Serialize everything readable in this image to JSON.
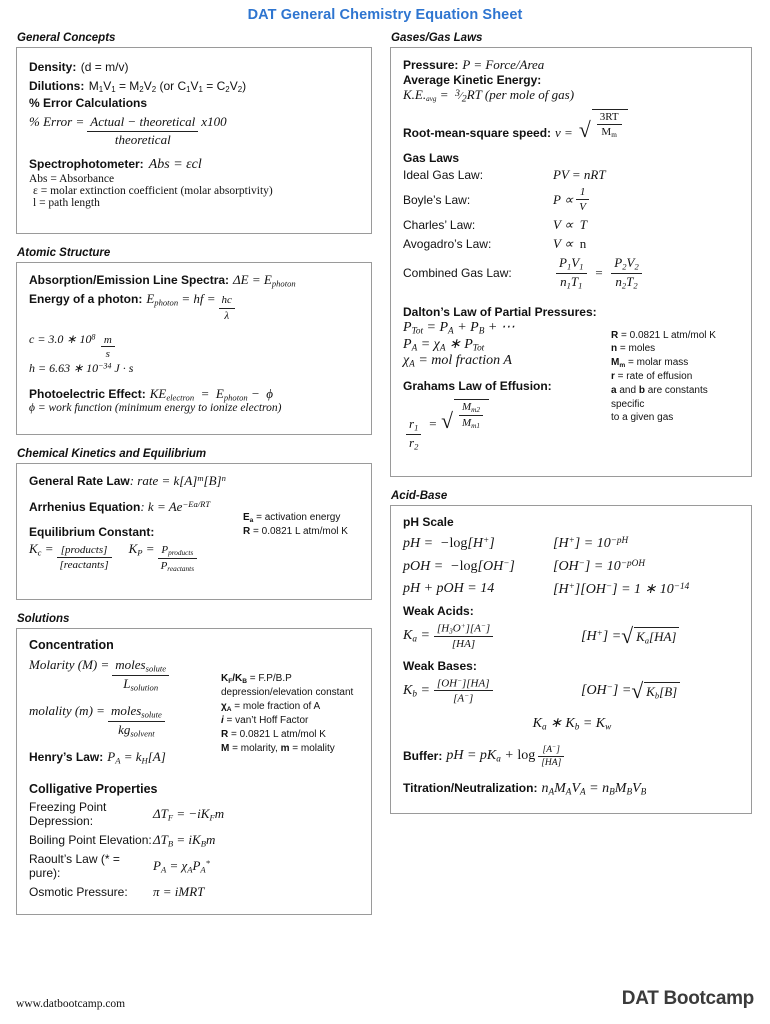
{
  "title": "DAT General Chemistry Equation Sheet",
  "title_color": "#2E75D0",
  "footer": {
    "url": "www.datbootcamp.com",
    "logo": "DAT Bootcamp"
  },
  "sections": {
    "general_concepts": {
      "heading": "General Concepts",
      "density_label": "Density:",
      "density_eq": "(d = m/v)",
      "dilutions_label": "Dilutions:",
      "dilutions_eq": "M1V1 = M2V2 (or C1V1 = C2V2)",
      "error_label": "% Error Calculations",
      "error_lhs": "% Error  = ",
      "error_num": "Actual − theoretical",
      "error_den": "theoretical",
      "error_tail": "x100",
      "spectro_label": "Spectrophotometer:",
      "spectro_eq": "Abs  =  εcl",
      "spectro_n1": "Abs = Absorbance",
      "spectro_n2": "ε = molar extinction coefficient (molar absorptivity)",
      "spectro_n3": "l = path length"
    },
    "atomic_structure": {
      "heading": "Atomic Structure",
      "line_spectra_label": "Absorption/Emission Line Spectra:",
      "line_spectra_eq": "ΔE = E",
      "line_spectra_sub": "photon",
      "photon_label": "Energy of a photon:",
      "photon_lhs": "E",
      "photon_lhs_sub": "photon",
      "photon_mid": " = hf = ",
      "photon_num": "hc",
      "photon_den": "λ",
      "const_c": "c = 3.0 ∗ 10",
      "const_c_exp": "8",
      "const_c_num": "m",
      "const_c_den": "s",
      "const_h": "h = 6.63 ∗ 10",
      "const_h_exp": "−34",
      "const_h_unit": "J · s",
      "photoelectric_label": "Photoelectric Effect:",
      "photoelectric_eq": "KE",
      "photoelectric_sub": "electron",
      "photoelectric_mid": "  =  E",
      "photoelectric_sub2": "photon",
      "photoelectric_end": " −  ϕ",
      "work_note": "ϕ = work function (minimum energy to ionize electron)"
    },
    "kinetics": {
      "heading": "Chemical Kinetics and Equilibrium",
      "rate_label": "General Rate Law",
      "rate_eq": ": rate = k[A]",
      "rate_sup1": "m",
      "rate_b": "[B]",
      "rate_sup2": "n",
      "arrhenius_label": "Arrhenius Equation",
      "arrhenius_eq": ": k = Ae",
      "arrhenius_exp": "−Ea/RT",
      "equil_label": "Equilibrium Constant:",
      "kc": "K",
      "kc_sub": "c",
      "kc_num": "[products]",
      "kc_den": "[reactants]",
      "kp": "K",
      "kp_sub": "P",
      "kp_num": "P",
      "kp_num_sub": "products",
      "kp_den": "P",
      "kp_den_sub": "reactants",
      "notes": [
        {
          "sym": "E",
          "sub": "a",
          "text": " = activation energy"
        },
        {
          "sym": "R",
          "sub": "",
          "text": " = 0.0821 L atm/mol K"
        }
      ]
    },
    "solutions": {
      "heading": "Solutions",
      "conc_label": "Concentration",
      "molarity_lhs": "Molarity (M)  = ",
      "molarity_num": "moles",
      "molarity_num_sub": "solute",
      "molarity_den": "L",
      "molarity_den_sub": "solution",
      "molality_lhs": "molality (m)  = ",
      "molality_num": "moles",
      "molality_num_sub": "solute",
      "molality_den": "kg",
      "molality_den_sub": "solvent",
      "henry_label": "Henry’s Law:",
      "henry_eq": "P",
      "henry_sub": "A",
      "henry_rest": " = k",
      "henry_sub2": "H",
      "henry_end": "[A]",
      "notes": [
        "K_F/K_B = F.P/B.P depression/elevation constant",
        "χ_A = mole fraction of A",
        "i = van’t Hoff Factor",
        "R = 0.0821 L atm/mol K",
        "M = molarity, m = molality"
      ],
      "note_kf_sym": "K",
      "note_kf_sub": "F",
      "note_kb_sym": "K",
      "note_kb_sub": "B",
      "note_kf_text": " = F.P/B.P",
      "note_kf_text2": "depression/elevation",
      "note_kf_text3": "constant",
      "note_chi_sym": "χ",
      "note_chi_sub": "A",
      "note_chi_text": " = mole fraction of A",
      "note_i_sym": "i",
      "note_i_text": " = van’t Hoff Factor",
      "note_r_sym": "R",
      "note_r_text": " = 0.0821 L atm/mol K",
      "note_m_sym": "M",
      "note_m_text": " = molarity, ",
      "note_m_sym2": "m",
      "note_m_text2": " = molality",
      "colligative_label": "Colligative Properties",
      "colligative": [
        {
          "name": "Freezing Point Depression:",
          "eq": "ΔT_F = −iK_F m"
        },
        {
          "name": "Boiling Point Elevation:",
          "eq": "ΔT_B = iK_B m"
        },
        {
          "name": "Raoult’s Law (* = pure):",
          "eq": "P_A = χ_A P_A*"
        },
        {
          "name": "Osmotic Pressure:",
          "eq": "π = iMRT"
        }
      ]
    },
    "gases": {
      "heading": "Gases/Gas Laws",
      "pressure_label": "Pressure:",
      "pressure_eq": "P = Force/Area",
      "ake_label": "Average Kinetic Energy:",
      "ake_lhs": "K.E.",
      "ake_sub": "avg",
      "ake_eq": " =  ",
      "ake_num": "3",
      "ake_den": "2",
      "ake_rest": " RT (per mole of gas)",
      "rms_label": "Root-mean-square speed:",
      "rms_lhs": "v = ",
      "rms_num": "3RT",
      "rms_den": "M",
      "rms_den_sub": "m",
      "gas_laws_label": "Gas Laws",
      "laws": [
        {
          "name": "Ideal Gas Law:",
          "eq": "PV = nRT"
        },
        {
          "name": "Boyle’s Law:",
          "eq": "P ∝ 1/V"
        },
        {
          "name": "Charles’ Law:",
          "eq": "V ∝ T"
        },
        {
          "name": "Avogadro’s Law:",
          "eq": "V ∝ n"
        },
        {
          "name": "Combined Gas Law:",
          "eq": "P1V1/n1T1 = P2V2/n2T2"
        }
      ],
      "dalton_label": "Dalton’s Law of Partial Pressures:",
      "dalton_1": "P",
      "dalton_1_sub": "Tot",
      "dalton_1_rest": " = P",
      "dalton_1_sub2": "A",
      "dalton_1_rest2": " + P",
      "dalton_1_sub3": "B",
      "dalton_1_end": " + ⋯",
      "dalton_2": "P",
      "dalton_2_sub": "A",
      "dalton_2_rest": " = χ",
      "dalton_2_sub2": "A",
      "dalton_2_rest2": " ∗ P",
      "dalton_2_sub3": "Tot",
      "dalton_3": "χ",
      "dalton_3_sub": "A",
      "dalton_3_rest": " = mol fraction A",
      "graham_label": "Grahams Law of Effusion:",
      "graham_num": "r",
      "graham_num_sub": "1",
      "graham_den": "r",
      "graham_den_sub": "2",
      "graham_rnum": "M",
      "graham_rnum_sub": "m2",
      "graham_rden": "M",
      "graham_rden_sub": "m1",
      "notes": [
        "R = 0.0821 L atm/mol K",
        "n = moles",
        "M_m = molar mass",
        "r = rate of effusion",
        "a and b are constants specific to a given gas"
      ],
      "note_r_sym": "R",
      "note_r_text": " = 0.0821 L atm/mol K",
      "note_n_sym": "n",
      "note_n_text": " = moles",
      "note_mm_sym": "M",
      "note_mm_sub": "m",
      "note_mm_text": " = molar mass",
      "note_rr_sym": "r",
      "note_rr_text": " = rate of effusion",
      "note_ab_sym": "a",
      "note_ab_mid": " and ",
      "note_ab_sym2": "b",
      "note_ab_text": " are constants specific",
      "note_ab_text2": "to a given gas"
    },
    "acid_base": {
      "heading": "Acid-Base",
      "ph_label": "pH Scale",
      "ph_1a": "pH =  −log[H",
      "ph_1a_sup": "+",
      "ph_1a_end": "]",
      "ph_1b": "[H",
      "ph_1b_sup": "+",
      "ph_1b_mid": "] = 10",
      "ph_1b_exp": "−pH",
      "ph_2a": "pOH =  −log[OH",
      "ph_2a_sup": "−",
      "ph_2a_end": "]",
      "ph_2b": "[OH",
      "ph_2b_sup": "−",
      "ph_2b_mid": "] = 10",
      "ph_2b_exp": "−pOH",
      "ph_3a": "pH + pOH = 14",
      "ph_3b": "[H",
      "ph_3b_sup": "+",
      "ph_3b_mid": "][OH",
      "ph_3b_sup2": "−",
      "ph_3b_end": "] = 1 ∗ 10",
      "ph_3b_exp": "−14",
      "weak_acids_label": "Weak Acids:",
      "ka_lhs": "K",
      "ka_sub": "a",
      "ka_num": "[H",
      "ka_num_sub": "3",
      "ka_num_o": "O",
      "ka_num_sup": "+",
      "ka_num_rest": "][A",
      "ka_num_sup2": "−",
      "ka_num_end": "]",
      "ka_den": "[HA]",
      "ka_right_lhs": "[H",
      "ka_right_sup": "+",
      "ka_right_mid": "] = ",
      "ka_right_rad": "K",
      "ka_right_rad_sub": "a",
      "ka_right_rad_rest": "[HA]",
      "weak_bases_label": "Weak Bases:",
      "kb_lhs": "K",
      "kb_sub": "b",
      "kb_num": "[OH",
      "kb_num_sup": "−",
      "kb_num_rest": "][HA]",
      "kb_den": "[A",
      "kb_den_sup": "−",
      "kb_den_end": "]",
      "kb_right_lhs": "[OH",
      "kb_right_sup": "−",
      "kb_right_mid": "] = ",
      "kb_right_rad": "K",
      "kb_right_rad_sub": "b",
      "kb_right_rad_rest": "[B]",
      "kakb_eq": "K_a ∗ K_b = K_w",
      "kakb_a": "K",
      "kakb_a_sub": "a",
      "kakb_mid": " ∗ K",
      "kakb_b_sub": "b",
      "kakb_end": " = K",
      "kakb_w_sub": "w",
      "buffer_label": "Buffer:",
      "buffer_lhs": "pH = pK",
      "buffer_sub": "a",
      "buffer_mid": " + log",
      "buffer_num": "[A",
      "buffer_num_sup": "−",
      "buffer_num_end": "]",
      "buffer_den": "[HA]",
      "titration_label": "Titration/Neutralization:",
      "titration_eq": "n",
      "titration_sub1": "A",
      "titration_m": "M",
      "titration_sub2": "A",
      "titration_v": "V",
      "titration_sub3": "A",
      "titration_eqsign": " = n",
      "titration_sub4": "B",
      "titration_m2": "M",
      "titration_sub5": "B",
      "titration_v2": "V",
      "titration_sub6": "B"
    }
  }
}
